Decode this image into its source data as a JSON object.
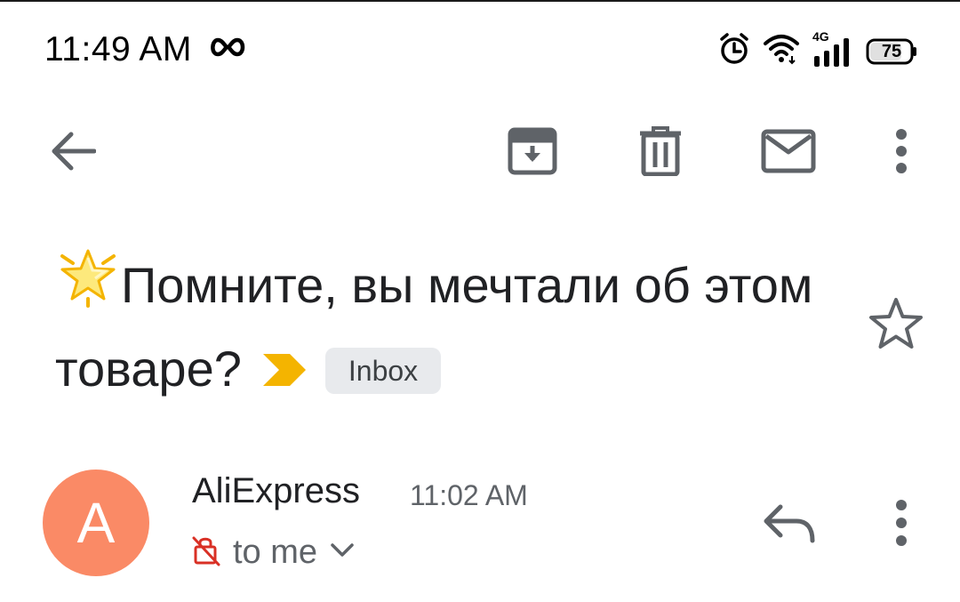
{
  "status_bar": {
    "time": "11:49 AM",
    "network_type": "4G",
    "battery_level": "75",
    "icons": [
      "infinity-icon",
      "alarm-icon",
      "wifi-icon",
      "signal-icon",
      "battery-icon"
    ]
  },
  "toolbar": {
    "icons": [
      "back-arrow-icon",
      "archive-icon",
      "trash-icon",
      "mark-unread-icon",
      "more-vert-icon"
    ]
  },
  "email": {
    "subject": "Помните, вы мечтали об этом товаре?",
    "subject_emoji": "glowing-star-icon",
    "importance_marker": "importance-chevron-icon",
    "label": "Inbox",
    "starred": false
  },
  "sender": {
    "avatar_letter": "A",
    "name": "AliExpress",
    "time": "11:02 AM",
    "recipient": "to me",
    "icons": [
      "encryption-warning-icon",
      "chevron-down-icon",
      "reply-icon",
      "more-vert-icon"
    ]
  },
  "colors": {
    "avatar_bg": "#fa8a66",
    "importance_yellow": "#f4b400",
    "chip_bg": "#e8eaed",
    "icon_gray": "#5f6368",
    "warning_red": "#d93025"
  }
}
